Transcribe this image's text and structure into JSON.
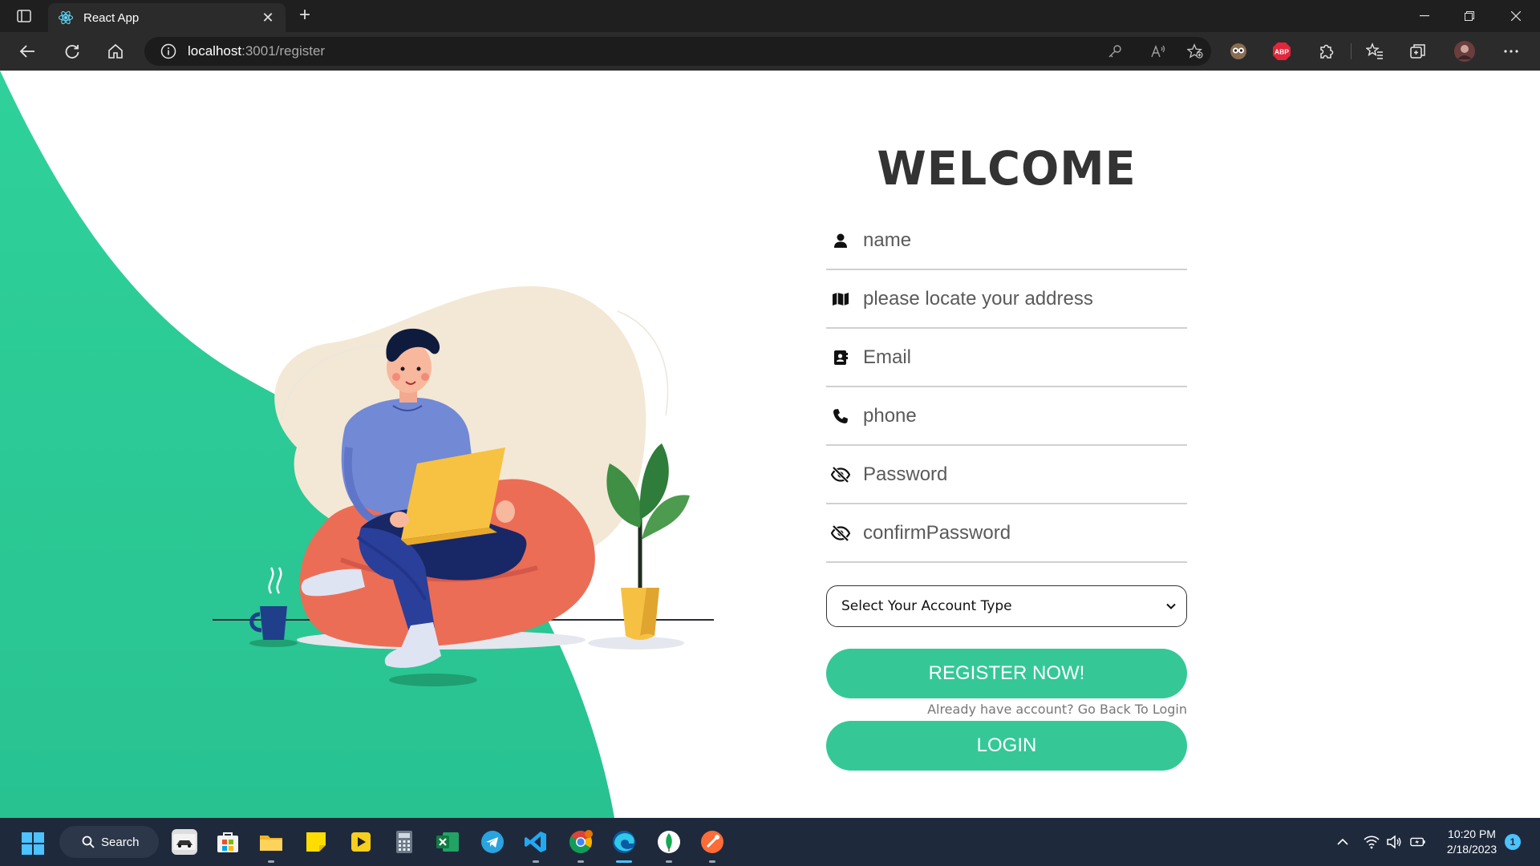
{
  "browser": {
    "tab_title": "React App",
    "url_host": "localhost",
    "url_path": ":3001/register"
  },
  "form": {
    "heading": "WELCOME",
    "fields": [
      {
        "placeholder": "name",
        "icon": "user-icon"
      },
      {
        "placeholder": "please locate your address",
        "icon": "map-icon"
      },
      {
        "placeholder": "Email",
        "icon": "contact-card-icon"
      },
      {
        "placeholder": "phone",
        "icon": "phone-icon"
      },
      {
        "placeholder": "Password",
        "icon": "eye-slash-icon"
      },
      {
        "placeholder": "confirmPassword",
        "icon": "eye-slash-icon"
      }
    ],
    "account_type_selected": "Select Your Account Type",
    "register_label": "REGISTER NOW!",
    "already_text": "Already have account? Go Back To Login",
    "login_label": "LOGIN"
  },
  "taskbar": {
    "search_label": "Search",
    "time": "10:20 PM",
    "date": "2/18/2023",
    "notification_count": "1"
  },
  "colors": {
    "accent_green": "#35c896",
    "wave_green": "#2ecc94",
    "heading": "#333333"
  }
}
